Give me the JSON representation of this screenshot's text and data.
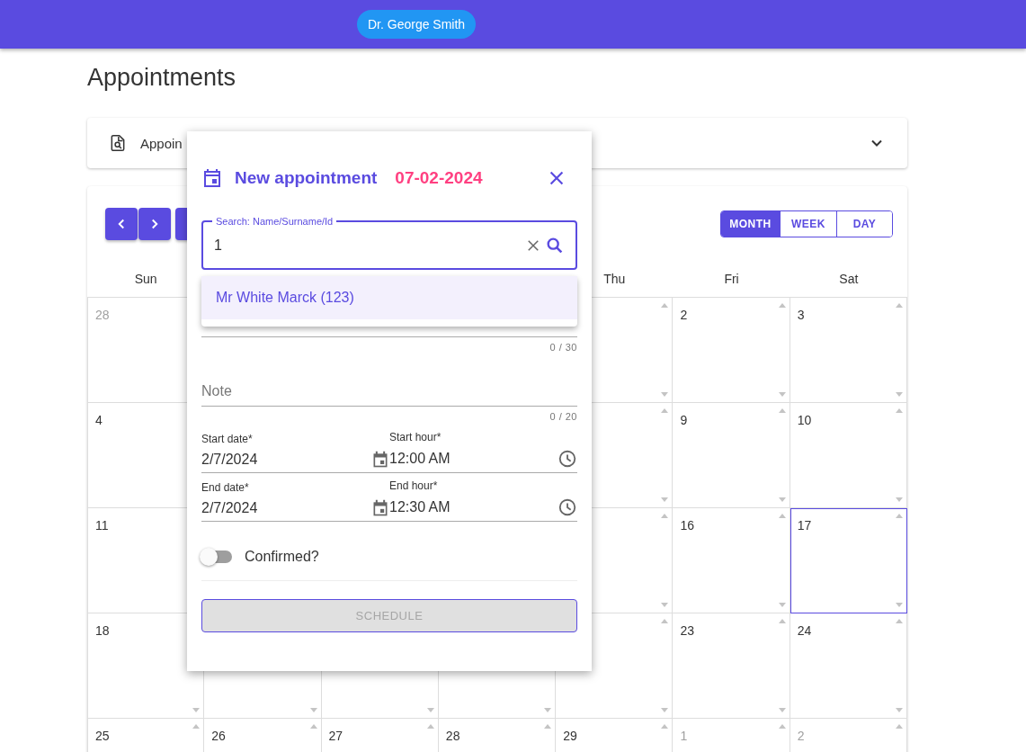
{
  "app_bar": {
    "user_chip": "Dr. George Smith"
  },
  "page": {
    "title": "Appointments"
  },
  "filter_panel": {
    "label": "Appoin",
    "expanded": false
  },
  "calendar": {
    "view_options": [
      {
        "label": "MONTH",
        "selected": true
      },
      {
        "label": "WEEK",
        "selected": false
      },
      {
        "label": "DAY",
        "selected": false
      }
    ],
    "weekdays": {
      "sun": "Sun",
      "thu": "Thu",
      "fri": "Fri",
      "sat": "Sat"
    },
    "weeks": [
      {
        "sun": {
          "day": "28",
          "other_month": true,
          "selected": false
        },
        "fri": {
          "day": "2",
          "other_month": false,
          "selected": false
        },
        "sat": {
          "day": "3",
          "other_month": false,
          "selected": false
        }
      },
      {
        "sun": {
          "day": "4",
          "other_month": false,
          "selected": false
        },
        "fri": {
          "day": "9",
          "other_month": false,
          "selected": false
        },
        "sat": {
          "day": "10",
          "other_month": false,
          "selected": false
        }
      },
      {
        "sun": {
          "day": "11",
          "other_month": false,
          "selected": false
        },
        "fri": {
          "day": "16",
          "other_month": false,
          "selected": false
        },
        "sat": {
          "day": "17",
          "other_month": false,
          "selected": true
        }
      },
      {
        "sun": {
          "day": "18",
          "other_month": false,
          "selected": false
        },
        "fri": {
          "day": "23",
          "other_month": false,
          "selected": false
        },
        "sat": {
          "day": "24",
          "other_month": false,
          "selected": false
        }
      },
      {
        "sun": {
          "day": "25",
          "other_month": false,
          "selected": false
        },
        "mon": {
          "day": "26",
          "other_month": false,
          "selected": false
        },
        "tue": {
          "day": "27",
          "other_month": false,
          "selected": false
        },
        "wed": {
          "day": "28",
          "other_month": false,
          "selected": false
        },
        "thu": {
          "day": "29",
          "other_month": false,
          "selected": false
        },
        "fri": {
          "day": "1",
          "other_month": true,
          "selected": false
        },
        "sat": {
          "day": "2",
          "other_month": true,
          "selected": false
        }
      }
    ]
  },
  "dialog": {
    "title": "New appointment",
    "date": "07-02-2024",
    "search": {
      "label": "Search: Name/Surname/Id",
      "value": "1"
    },
    "suggestions": [
      {
        "label": "Mr White Marck (123)",
        "selected": true
      }
    ],
    "covered_field": {
      "counter": "0 / 30"
    },
    "note": {
      "placeholder": "Note",
      "counter": "0 / 20"
    },
    "start": {
      "date_label": "Start date*",
      "date": "2/7/2024",
      "hour_label": "Start hour*",
      "hour": "12:00 AM"
    },
    "end": {
      "date_label": "End date*",
      "date": "2/7/2024",
      "hour_label": "End hour*",
      "hour": "12:30 AM"
    },
    "confirmed": {
      "label": "Confirmed?",
      "on": false
    },
    "submit": {
      "label": "SCHEDULE",
      "disabled": true
    }
  }
}
